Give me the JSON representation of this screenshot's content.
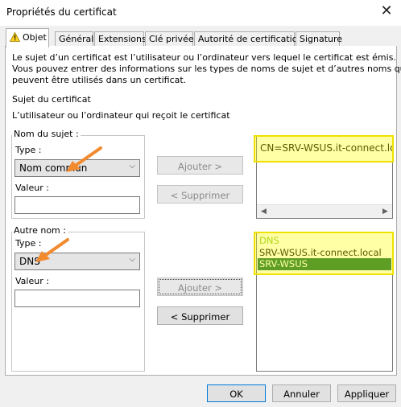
{
  "window": {
    "title": "Propriétés du certificat",
    "close": "✕"
  },
  "tabs": [
    {
      "label": "Objet"
    },
    {
      "label": "Général"
    },
    {
      "label": "Extensions"
    },
    {
      "label": "Clé privée"
    },
    {
      "label": "Autorité de certification"
    },
    {
      "label": "Signature"
    }
  ],
  "intro": {
    "line1": "Le sujet d’un certificat est l’utilisateur ou l’ordinateur vers lequel le certificat est émis.",
    "line2": "Vous pouvez entrer des informations sur les types de noms de sujet et d’autres noms qui",
    "line3": "peuvent être utilisés dans un certificat."
  },
  "subject": {
    "heading": "Sujet du certificat",
    "description": "L’utilisateur ou l’ordinateur qui reçoit le certificat"
  },
  "subject_name": {
    "group_title": "Nom du sujet :",
    "type_label": "Type :",
    "type_value": "Nom commun",
    "value_label": "Valeur :",
    "value": "",
    "add_button": "Ajouter >",
    "remove_button": "< Supprimer",
    "list": [
      "CN=SRV-WSUS.it-connect.local"
    ]
  },
  "alt_name": {
    "group_title": "Autre nom :",
    "type_label": "Type :",
    "type_value": "DNS",
    "value_label": "Valeur :",
    "value": "",
    "add_button": "Ajouter >",
    "remove_button": "< Supprimer",
    "list_header": "DNS",
    "list": [
      "SRV-WSUS.it-connect.local",
      "SRV-WSUS"
    ],
    "selected_index": 1
  },
  "footer": {
    "ok": "OK",
    "cancel": "Annuler",
    "apply": "Appliquer"
  },
  "colors": {
    "selection": "#0a6b3a",
    "highlight": "#ffff00",
    "annotation_arrow": "#f28a2e",
    "accent": "#0078d7"
  },
  "icons": {
    "warning": "warning-icon",
    "arrow": "annotation-arrow-icon"
  }
}
